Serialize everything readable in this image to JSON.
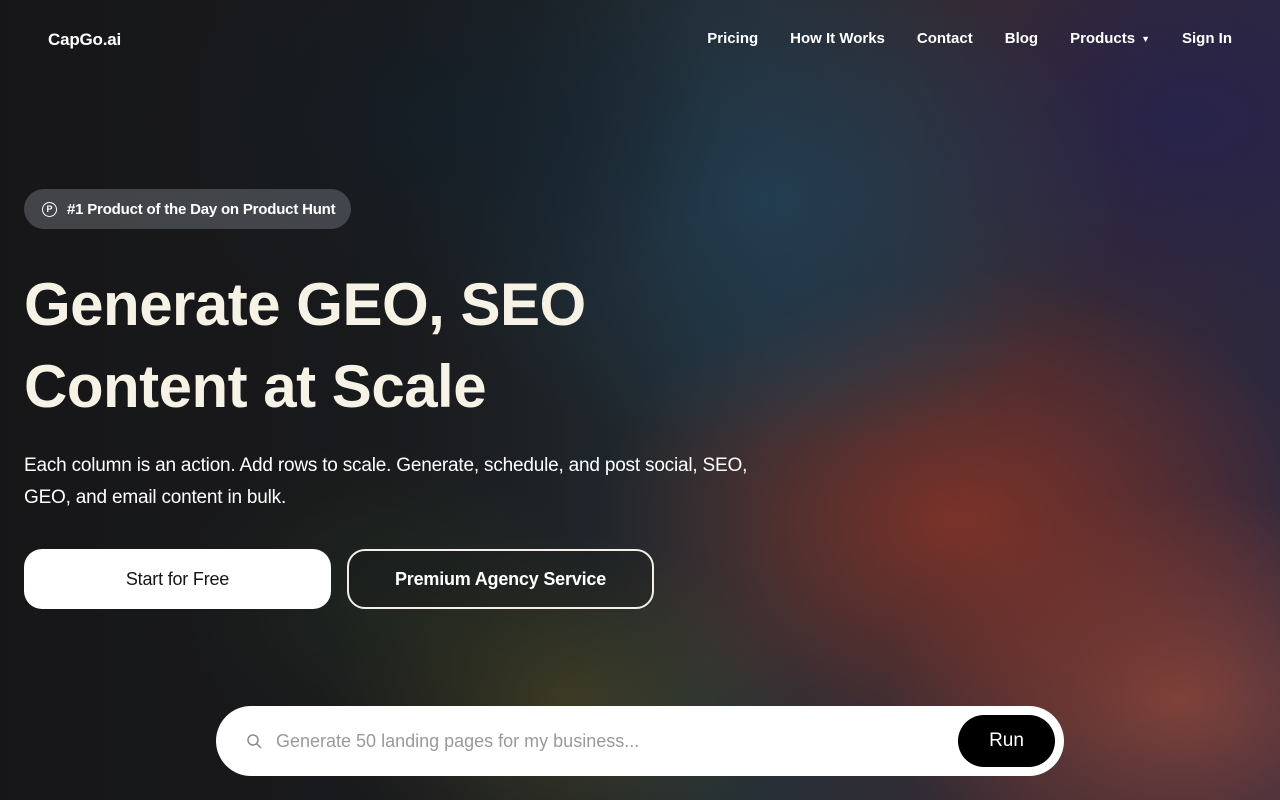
{
  "brand": {
    "name": "CapGo.ai"
  },
  "nav": {
    "items": [
      {
        "label": "Pricing"
      },
      {
        "label": "How It Works"
      },
      {
        "label": "Contact"
      },
      {
        "label": "Blog"
      },
      {
        "label": "Products",
        "has_dropdown": true
      },
      {
        "label": "Sign In"
      }
    ],
    "caret_icon": "caret-down-icon"
  },
  "badge": {
    "icon": "product-hunt-icon",
    "icon_glyph": "P",
    "text": "#1 Product of the Day on Product Hunt"
  },
  "hero": {
    "title_line1": "Generate GEO, SEO",
    "title_line2": "Content at Scale",
    "subtitle": "Each column is an action. Add rows to scale. Generate, schedule, and post social, SEO, GEO, and email content in bulk."
  },
  "cta": {
    "primary_label": "Start for Free",
    "secondary_label": "Premium Agency Service"
  },
  "search": {
    "icon": "search-icon",
    "placeholder": "Generate 50 landing pages for my business...",
    "value": "",
    "run_label": "Run"
  },
  "colors": {
    "title": "#f7f2e6",
    "primary_button_bg": "#ffffff",
    "run_button_bg": "#000000"
  }
}
